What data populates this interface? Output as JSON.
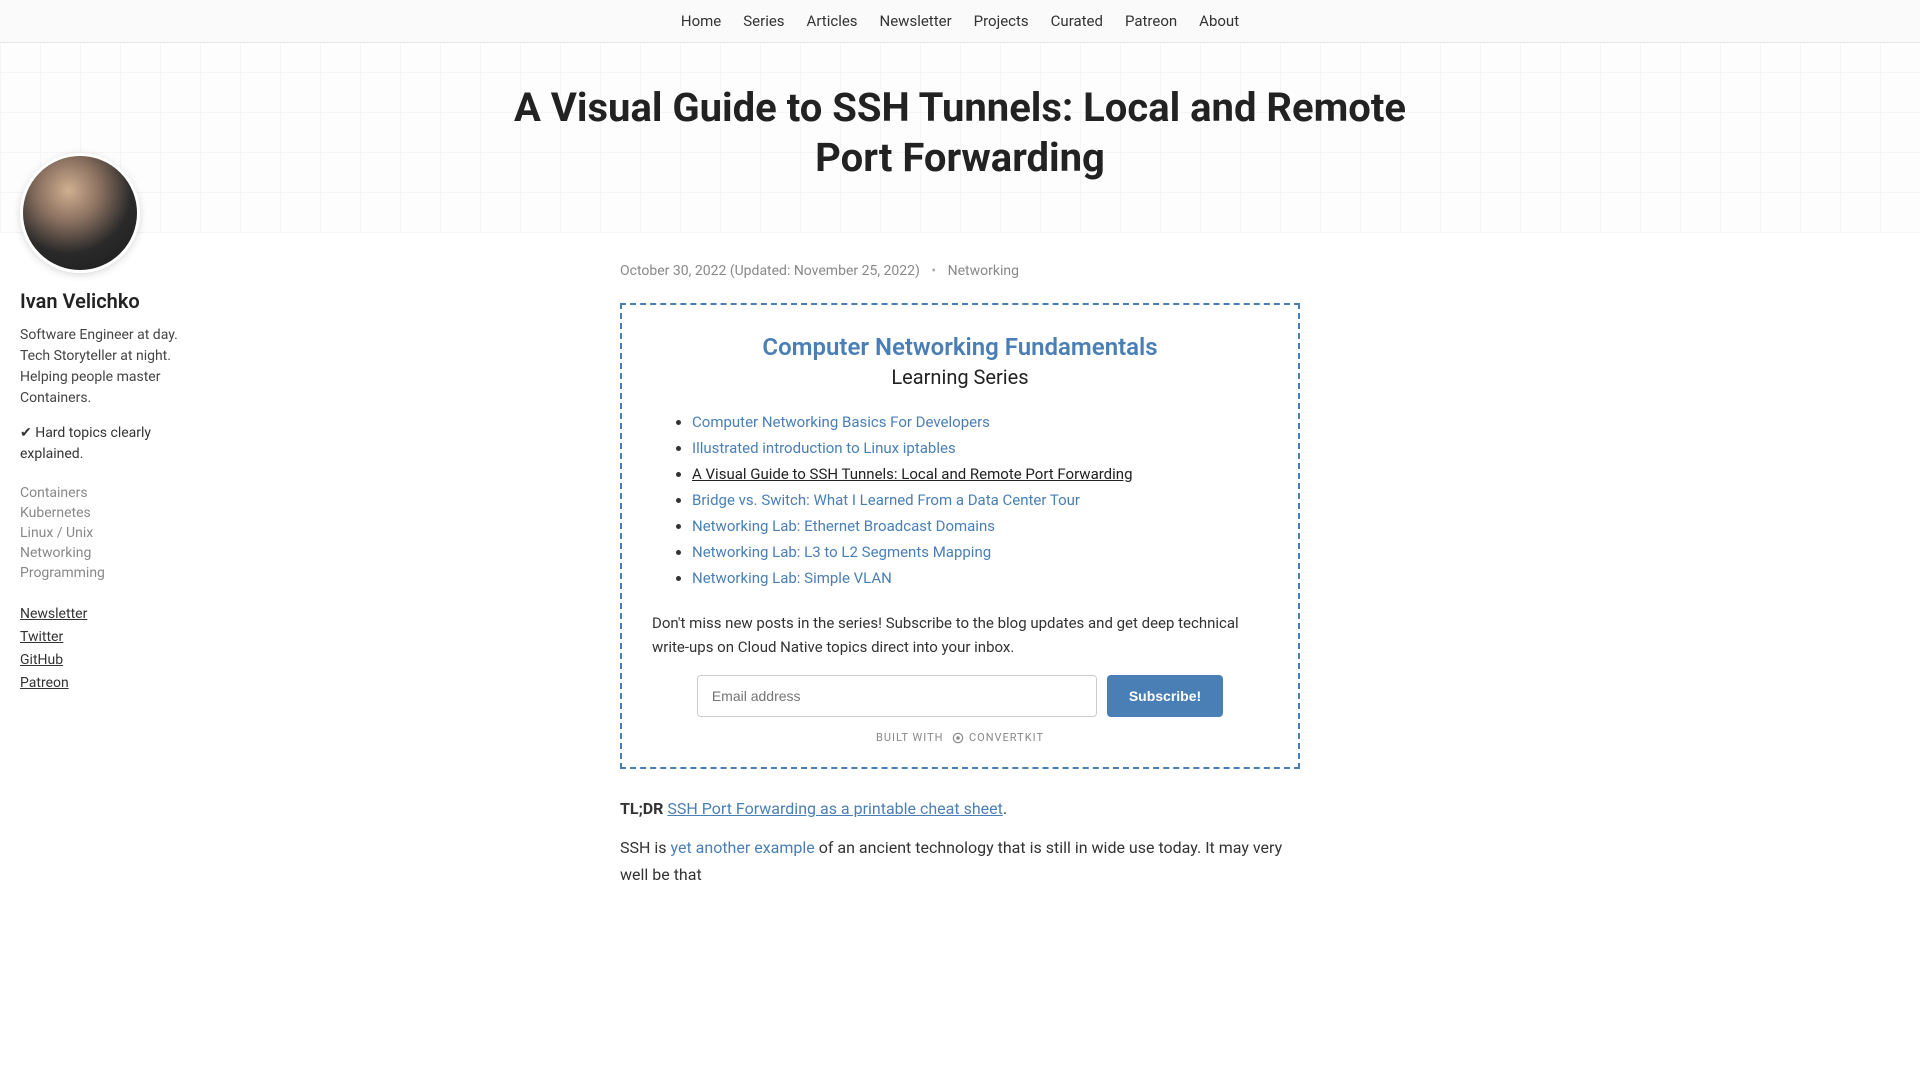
{
  "nav": {
    "items": [
      "Home",
      "Series",
      "Articles",
      "Newsletter",
      "Projects",
      "Curated",
      "Patreon",
      "About"
    ]
  },
  "hero": {
    "title": "A Visual Guide to SSH Tunnels: Local and Remote Port Forwarding"
  },
  "sidebar": {
    "author_name": "Ivan Velichko",
    "bio": "Software Engineer at day. Tech Storyteller at night. Helping people master Containers.",
    "tagline": "✔ Hard topics clearly explained.",
    "tags": [
      "Containers",
      "Kubernetes",
      "Linux / Unix",
      "Networking",
      "Programming"
    ],
    "socials": [
      "Newsletter",
      "Twitter",
      "GitHub",
      "Patreon"
    ]
  },
  "meta": {
    "date": "October 30, 2022",
    "updated": "(Updated: November 25, 2022)",
    "category": "Networking"
  },
  "series": {
    "title": "Computer Networking Fundamentals",
    "subtitle": "Learning Series",
    "items": [
      {
        "label": "Computer Networking Basics For Developers",
        "current": false
      },
      {
        "label": "Illustrated introduction to Linux iptables",
        "current": false
      },
      {
        "label": "A Visual Guide to SSH Tunnels: Local and Remote Port Forwarding",
        "current": true
      },
      {
        "label": "Bridge vs. Switch: What I Learned From a Data Center Tour",
        "current": false
      },
      {
        "label": "Networking Lab: Ethernet Broadcast Domains",
        "current": false
      },
      {
        "label": "Networking Lab: L3 to L2 Segments Mapping",
        "current": false
      },
      {
        "label": "Networking Lab: Simple VLAN",
        "current": false
      }
    ],
    "cta": "Don't miss new posts in the series! Subscribe to the blog updates and get deep technical write-ups on Cloud Native topics direct into your inbox.",
    "email_placeholder": "Email address",
    "subscribe_label": "Subscribe!",
    "badge_prefix": "BUILT WITH",
    "badge_brand": "ConvertKit"
  },
  "body": {
    "tldr_label": "TL;DR",
    "tldr_link": "SSH Port Forwarding as a printable cheat sheet",
    "tldr_suffix": ".",
    "para2_prefix": "SSH is ",
    "para2_link": "yet another example",
    "para2_suffix": " of an ancient technology that is still in wide use today. It may very well be that"
  }
}
